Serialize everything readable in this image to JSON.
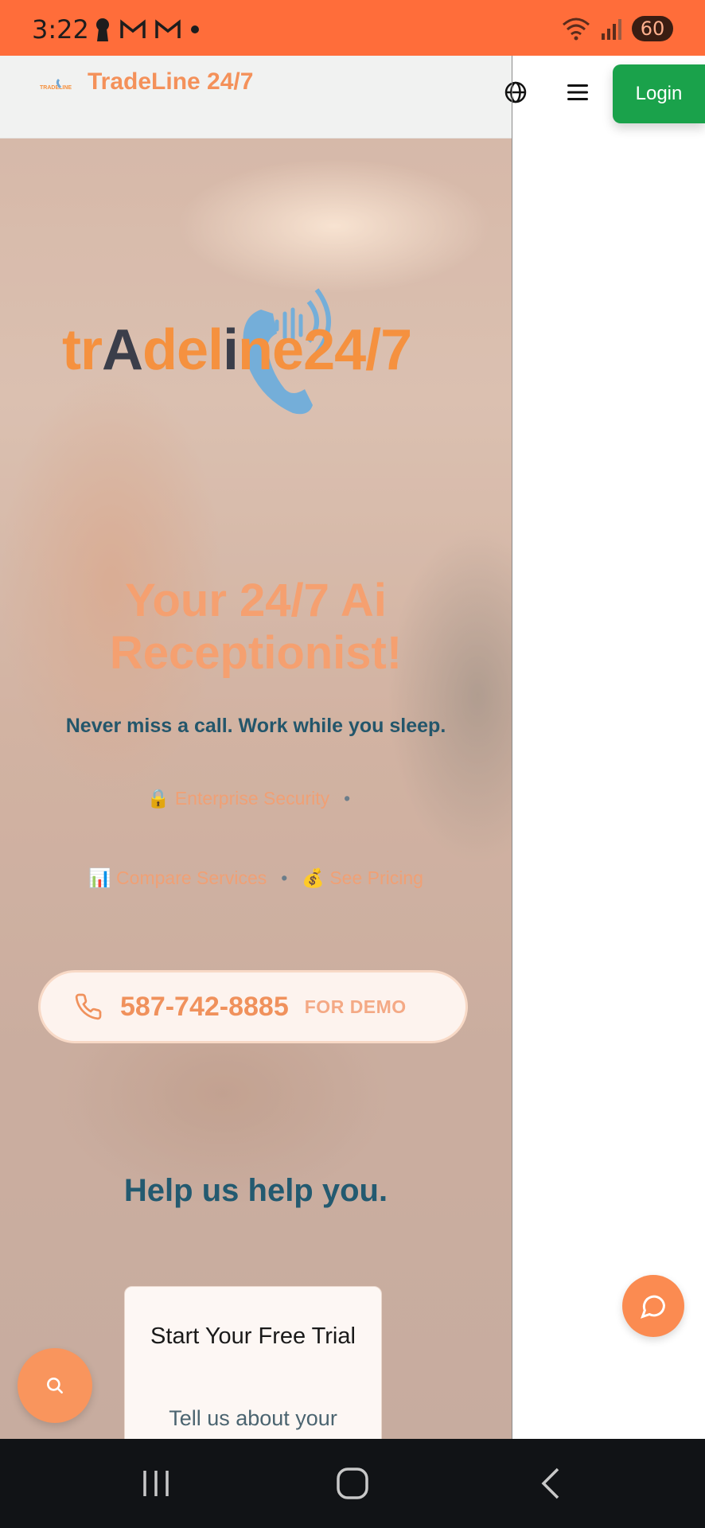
{
  "status_bar": {
    "time": "3:22",
    "battery": "60"
  },
  "header": {
    "brand_name": "TradeLine 24/7",
    "login_label": "Login"
  },
  "hero": {
    "logo_text_parts": [
      "tr",
      "A",
      "del",
      "i",
      "ne",
      "24/7"
    ],
    "title_line1": "Your 24/7 Ai",
    "title_line2": "Receptionist!",
    "subtitle": "Never miss a call. Work while you sleep.",
    "links": {
      "enterprise_security": "🔒 Enterprise Security",
      "compare_services": "📊 Compare Services",
      "see_pricing": "💰 See Pricing",
      "separator": "•"
    },
    "demo": {
      "phone_number": "587-742-8885",
      "label": "FOR DEMO"
    },
    "help_title": "Help us help you.",
    "trial_card": {
      "title": "Start Your Free Trial",
      "description": "Tell us about your"
    }
  },
  "colors": {
    "status_bar": "#ff6d3a",
    "brand_orange": "#f5913f",
    "login_green": "#1aa24b",
    "heading_teal": "#235a70",
    "fab_orange": "#f9955d"
  },
  "icons": {
    "globe": "globe-icon",
    "menu": "hamburger-menu-icon",
    "phone": "phone-icon",
    "search": "search-icon",
    "chat": "chat-bubble-icon"
  }
}
